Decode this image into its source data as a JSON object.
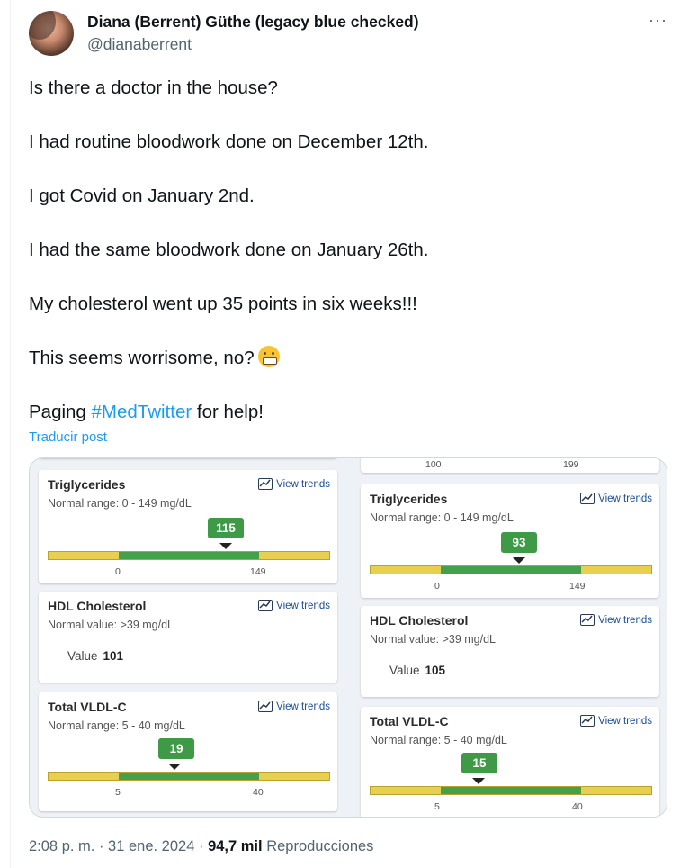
{
  "author": {
    "name": "Diana (Berrent) Güthe (legacy blue checked)",
    "handle": "@dianaberrent",
    "more_icon": "···"
  },
  "post": {
    "paragraphs": [
      "Is there a doctor in the house?",
      "I had routine bloodwork done on December 12th.",
      "I got Covid on January 2nd.",
      "I had the same bloodwork done on January 26th.",
      "My cholesterol went up 35 points in six weeks!!!",
      "This seems worrisome, no?"
    ],
    "last_prefix": "Paging ",
    "hashtag": "#MedTwitter",
    "last_suffix": " for help!",
    "translate": "Traducir post"
  },
  "media": {
    "view_trends": "View trends",
    "left": {
      "triglycerides": {
        "title": "Triglycerides",
        "range": "Normal range: 0 - 149 mg/dL",
        "value": "115",
        "tick_low": "0",
        "tick_high": "149"
      },
      "hdl": {
        "title": "HDL Cholesterol",
        "range": "Normal value: >39 mg/dL",
        "value_label": "Value",
        "value": "101"
      },
      "vldl": {
        "title": "Total VLDL-C",
        "range": "Normal range: 5 - 40 mg/dL",
        "value": "19",
        "tick_low": "5",
        "tick_high": "40"
      }
    },
    "right": {
      "top_ticks": {
        "low": "100",
        "high": "199"
      },
      "triglycerides": {
        "title": "Triglycerides",
        "range": "Normal range: 0 - 149 mg/dL",
        "value": "93",
        "tick_low": "0",
        "tick_high": "149"
      },
      "hdl": {
        "title": "HDL Cholesterol",
        "range": "Normal value: >39 mg/dL",
        "value_label": "Value",
        "value": "105"
      },
      "vldl": {
        "title": "Total VLDL-C",
        "range": "Normal range: 5 - 40 mg/dL",
        "value": "15",
        "tick_low": "5",
        "tick_high": "40"
      }
    },
    "colors": {
      "normal": "#43a04b",
      "borderline": "#e8cf4f",
      "badge": "#3f9a47"
    }
  },
  "footer": {
    "time": "2:08 p. m.",
    "sep1": " · ",
    "date": "31 ene. 2024",
    "sep2": " · ",
    "views": "94,7 mil",
    "views_label": " Reproducciones"
  }
}
